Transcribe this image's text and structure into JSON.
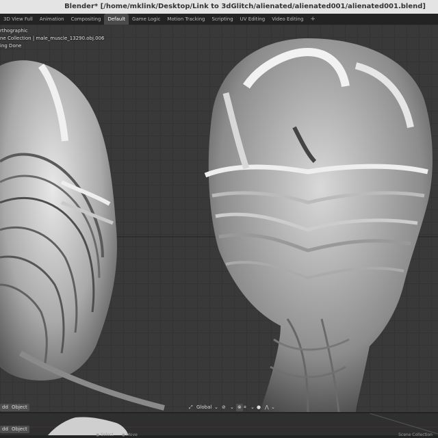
{
  "window": {
    "title": "Blender* [/home/mklink/Desktop/Link to 3dGlitch/alienated/alienated001/alienated001.blend]"
  },
  "workspace_tabs": [
    "3D View Full",
    "Animation",
    "Compositing",
    "Default",
    "Game Logic",
    "Motion Tracking",
    "Scripting",
    "UV Editing",
    "Video Editing"
  ],
  "active_tab": "Default",
  "add_tab": "+",
  "viewport": {
    "projection": "rthographic",
    "collection_info": "ne Collection | male_muscle_13290.obj.006",
    "status": "ing Done"
  },
  "header": {
    "add_label": "dd",
    "object_label": "Object",
    "orientation": "Global"
  },
  "bottom": {
    "add_label": "dd",
    "object_label": "Object",
    "select_label": "Select",
    "move_label": "Move",
    "collection_label": "Scene Collection"
  },
  "colors": {
    "accent": "#4a4a4a",
    "titlebar": "#e4e4e4",
    "viewport": "#393939"
  }
}
